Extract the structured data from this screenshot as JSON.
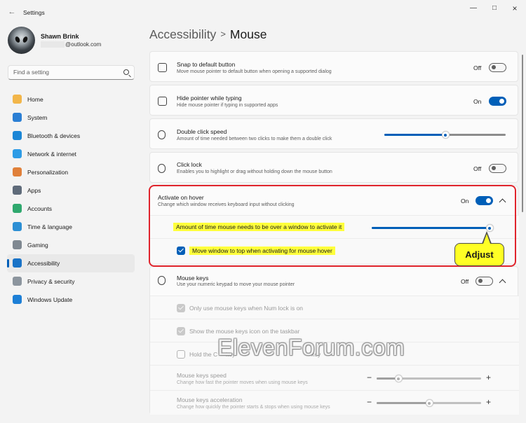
{
  "window": {
    "title": "Settings"
  },
  "profile": {
    "name": "Shawn Brink",
    "email": "@outlook.com"
  },
  "search": {
    "placeholder": "Find a setting"
  },
  "nav": [
    {
      "label": "Home",
      "color": "#f2b64a"
    },
    {
      "label": "System",
      "color": "#2b7fd4"
    },
    {
      "label": "Bluetooth & devices",
      "color": "#1b86d6"
    },
    {
      "label": "Network & internet",
      "color": "#2e9ce6"
    },
    {
      "label": "Personalization",
      "color": "#e0803a"
    },
    {
      "label": "Apps",
      "color": "#5f6b7a"
    },
    {
      "label": "Accounts",
      "color": "#2fa86e"
    },
    {
      "label": "Time & language",
      "color": "#2c8fd4"
    },
    {
      "label": "Gaming",
      "color": "#7f8891"
    },
    {
      "label": "Accessibility",
      "color": "#1a73c7"
    },
    {
      "label": "Privacy & security",
      "color": "#8c959e"
    },
    {
      "label": "Windows Update",
      "color": "#1d7fd6"
    }
  ],
  "header": {
    "crumb": "Accessibility",
    "separator": ">",
    "title": "Mouse"
  },
  "settings": {
    "snap": {
      "title": "Snap to default button",
      "desc": "Move mouse pointer to default button when opening a supported dialog",
      "state": "Off"
    },
    "hide": {
      "title": "Hide pointer while typing",
      "desc": "Hide mouse pointer if typing in supported apps",
      "state": "On"
    },
    "dblclick": {
      "title": "Double click speed",
      "desc": "Amount of time needed between two clicks to make them a double click",
      "value": 0.5
    },
    "clicklock": {
      "title": "Click lock",
      "desc": "Enables you to highlight or drag without holding down the mouse button",
      "state": "Off"
    },
    "hover": {
      "title": "Activate on hover",
      "desc": "Change which window receives keyboard input without clicking",
      "state": "On",
      "time_label": "Amount of time mouse needs to be over a window to activate it",
      "time_value": 1.0,
      "move_top_label": "Move window to top when activating for mouse hover"
    },
    "mousekeys": {
      "title": "Mouse keys",
      "desc": "Use your numeric keypad to move your mouse pointer",
      "state": "Off",
      "numlock_label": "Only use mouse keys when Num lock is on",
      "taskbar_label": "Show the mouse keys icon on the taskbar",
      "hold_label": "Hold the Ctrl key to speed up and the Shift key to slow down",
      "hold_label_visible_start": "Hold the C",
      "hold_label_visible_mid": "key",
      "hold_label_visible_end": "key",
      "speed_title": "Mouse keys speed",
      "speed_desc": "Change how fast the pointer moves when using mouse keys",
      "speed_value": 0.21,
      "accel_title": "Mouse keys acceleration",
      "accel_desc": "Change how quickly the pointer starts & stops when using mouse keys",
      "accel_value": 0.5
    }
  },
  "annotation": {
    "callout": "Adjust"
  },
  "watermark": "ElevenForum.com",
  "colors": {
    "accent": "#005fb8",
    "highlight": "#ffff3b",
    "redbox": "#e0242c"
  }
}
